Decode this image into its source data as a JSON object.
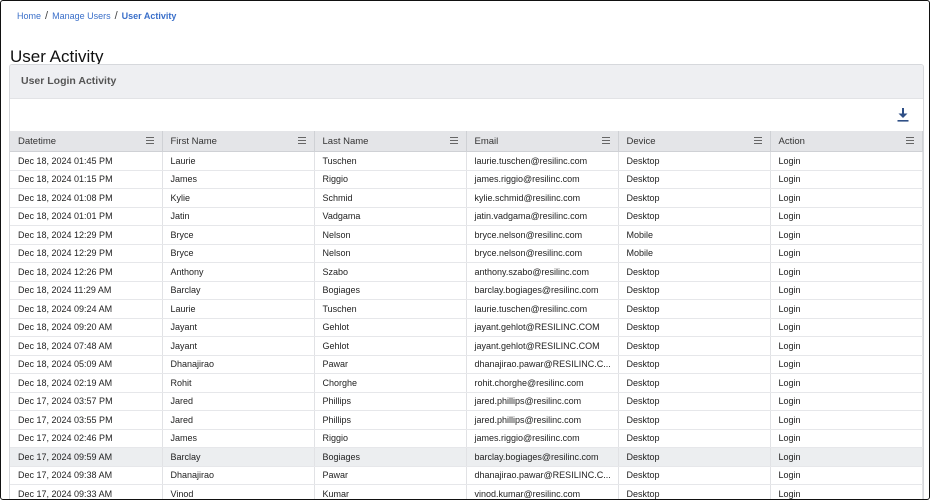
{
  "breadcrumb": {
    "home": "Home",
    "manage_users": "Manage Users",
    "current": "User Activity",
    "separator": "/"
  },
  "page": {
    "title": "User Activity"
  },
  "card": {
    "title": "User Login Activity",
    "download_icon": "download-icon"
  },
  "table": {
    "columns": [
      "Datetime",
      "First Name",
      "Last Name",
      "Email",
      "Device",
      "Action"
    ],
    "rows": [
      [
        "Dec 18, 2024 01:45 PM",
        "Laurie",
        "Tuschen",
        "laurie.tuschen@resilinc.com",
        "Desktop",
        "Login"
      ],
      [
        "Dec 18, 2024 01:15 PM",
        "James",
        "Riggio",
        "james.riggio@resilinc.com",
        "Desktop",
        "Login"
      ],
      [
        "Dec 18, 2024 01:08 PM",
        "Kylie",
        "Schmid",
        "kylie.schmid@resilinc.com",
        "Desktop",
        "Login"
      ],
      [
        "Dec 18, 2024 01:01 PM",
        "Jatin",
        "Vadgama",
        "jatin.vadgama@resilinc.com",
        "Desktop",
        "Login"
      ],
      [
        "Dec 18, 2024 12:29 PM",
        "Bryce",
        "Nelson",
        "bryce.nelson@resilinc.com",
        "Mobile",
        "Login"
      ],
      [
        "Dec 18, 2024 12:29 PM",
        "Bryce",
        "Nelson",
        "bryce.nelson@resilinc.com",
        "Mobile",
        "Login"
      ],
      [
        "Dec 18, 2024 12:26 PM",
        "Anthony",
        "Szabo",
        "anthony.szabo@resilinc.com",
        "Desktop",
        "Login"
      ],
      [
        "Dec 18, 2024 11:29 AM",
        "Barclay",
        "Bogiages",
        "barclay.bogiages@resilinc.com",
        "Desktop",
        "Login"
      ],
      [
        "Dec 18, 2024 09:24 AM",
        "Laurie",
        "Tuschen",
        "laurie.tuschen@resilinc.com",
        "Desktop",
        "Login"
      ],
      [
        "Dec 18, 2024 09:20 AM",
        "Jayant",
        "Gehlot",
        "jayant.gehlot@RESILINC.COM",
        "Desktop",
        "Login"
      ],
      [
        "Dec 18, 2024 07:48 AM",
        "Jayant",
        "Gehlot",
        "jayant.gehlot@RESILINC.COM",
        "Desktop",
        "Login"
      ],
      [
        "Dec 18, 2024 05:09 AM",
        "Dhanajirao",
        "Pawar",
        "dhanajirao.pawar@RESILINC.C...",
        "Desktop",
        "Login"
      ],
      [
        "Dec 18, 2024 02:19 AM",
        "Rohit",
        "Chorghe",
        "rohit.chorghe@resilinc.com",
        "Desktop",
        "Login"
      ],
      [
        "Dec 17, 2024 03:57 PM",
        "Jared",
        "Phillips",
        "jared.phillips@resilinc.com",
        "Desktop",
        "Login"
      ],
      [
        "Dec 17, 2024 03:55 PM",
        "Jared",
        "Phillips",
        "jared.phillips@resilinc.com",
        "Desktop",
        "Login"
      ],
      [
        "Dec 17, 2024 02:46 PM",
        "James",
        "Riggio",
        "james.riggio@resilinc.com",
        "Desktop",
        "Login"
      ],
      [
        "Dec 17, 2024 09:59 AM",
        "Barclay",
        "Bogiages",
        "barclay.bogiages@resilinc.com",
        "Desktop",
        "Login"
      ],
      [
        "Dec 17, 2024 09:38 AM",
        "Dhanajirao",
        "Pawar",
        "dhanajirao.pawar@RESILINC.C...",
        "Desktop",
        "Login"
      ],
      [
        "Dec 17, 2024 09:33 AM",
        "Vinod",
        "Kumar",
        "vinod.kumar@resilinc.com",
        "Desktop",
        "Login"
      ]
    ],
    "highlighted_row": 16
  },
  "colors": {
    "link": "#3a6fc9",
    "header_bg": "#eeeff2",
    "column_header_bg": "#e4e5e8",
    "icon": "#2f4f86"
  }
}
